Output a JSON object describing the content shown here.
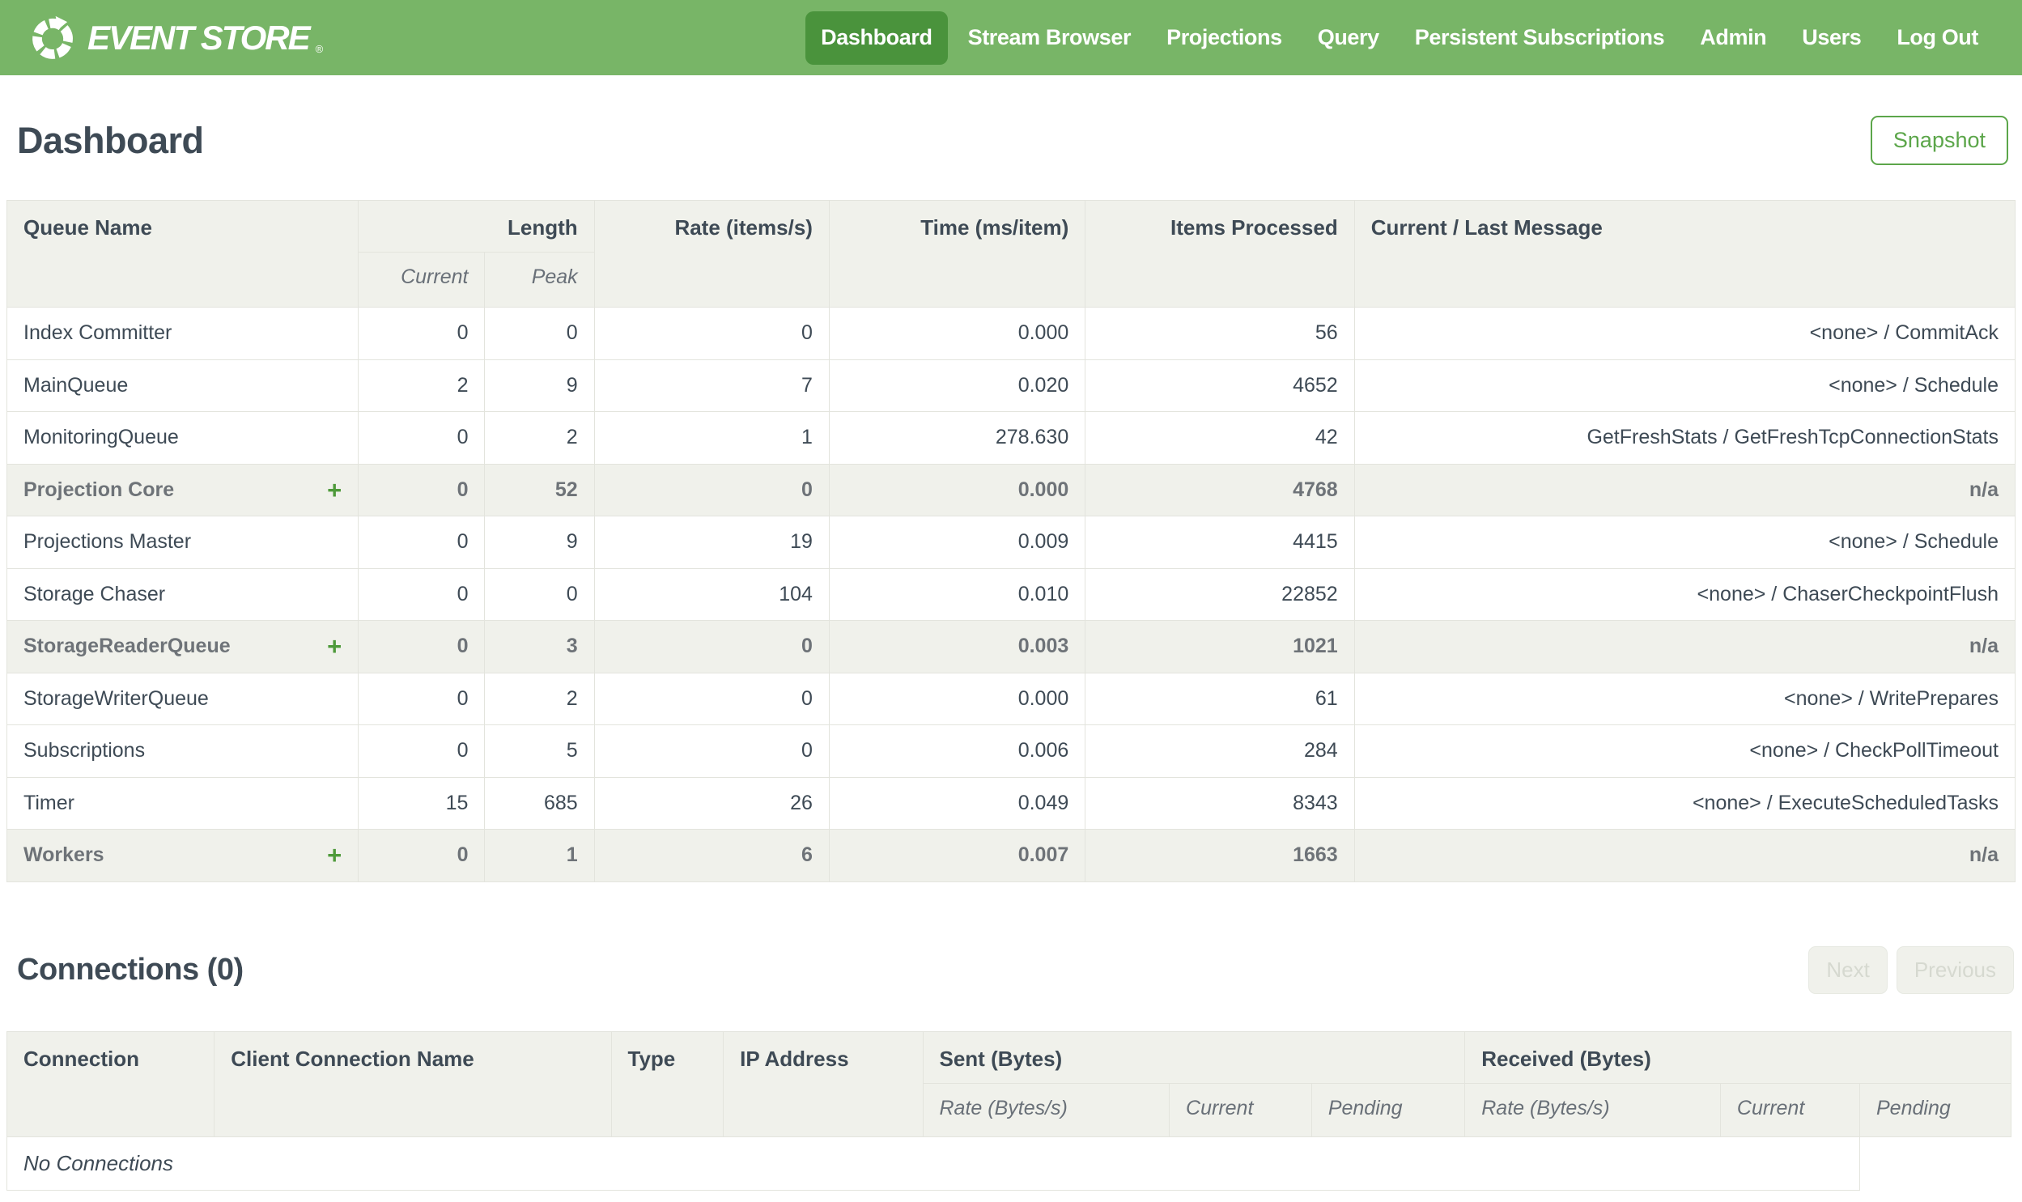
{
  "brand": {
    "name": "EVENT STORE",
    "registered": "®"
  },
  "nav": {
    "items": [
      {
        "label": "Dashboard",
        "active": true
      },
      {
        "label": "Stream Browser",
        "active": false
      },
      {
        "label": "Projections",
        "active": false
      },
      {
        "label": "Query",
        "active": false
      },
      {
        "label": "Persistent Subscriptions",
        "active": false
      },
      {
        "label": "Admin",
        "active": false
      },
      {
        "label": "Users",
        "active": false
      },
      {
        "label": "Log Out",
        "active": false
      }
    ]
  },
  "page": {
    "title": "Dashboard",
    "snapshot_label": "Snapshot"
  },
  "queues_table": {
    "expand_symbol": "+",
    "headers": {
      "queue_name": "Queue Name",
      "length": "Length",
      "current": "Current",
      "peak": "Peak",
      "rate": "Rate (items/s)",
      "time": "Time (ms/item)",
      "items_processed": "Items Processed",
      "message": "Current / Last Message"
    },
    "rows": [
      {
        "name": "Index Committer",
        "expandable": false,
        "current": "0",
        "peak": "0",
        "rate": "0",
        "time": "0.000",
        "items": "56",
        "message": "<none> / CommitAck"
      },
      {
        "name": "MainQueue",
        "expandable": false,
        "current": "2",
        "peak": "9",
        "rate": "7",
        "time": "0.020",
        "items": "4652",
        "message": "<none> / Schedule"
      },
      {
        "name": "MonitoringQueue",
        "expandable": false,
        "current": "0",
        "peak": "2",
        "rate": "1",
        "time": "278.630",
        "items": "42",
        "message": "GetFreshStats / GetFreshTcpConnectionStats"
      },
      {
        "name": "Projection Core",
        "expandable": true,
        "current": "0",
        "peak": "52",
        "rate": "0",
        "time": "0.000",
        "items": "4768",
        "message": "n/a"
      },
      {
        "name": "Projections Master",
        "expandable": false,
        "current": "0",
        "peak": "9",
        "rate": "19",
        "time": "0.009",
        "items": "4415",
        "message": "<none> / Schedule"
      },
      {
        "name": "Storage Chaser",
        "expandable": false,
        "current": "0",
        "peak": "0",
        "rate": "104",
        "time": "0.010",
        "items": "22852",
        "message": "<none> / ChaserCheckpointFlush"
      },
      {
        "name": "StorageReaderQueue",
        "expandable": true,
        "current": "0",
        "peak": "3",
        "rate": "0",
        "time": "0.003",
        "items": "1021",
        "message": "n/a"
      },
      {
        "name": "StorageWriterQueue",
        "expandable": false,
        "current": "0",
        "peak": "2",
        "rate": "0",
        "time": "0.000",
        "items": "61",
        "message": "<none> / WritePrepares"
      },
      {
        "name": "Subscriptions",
        "expandable": false,
        "current": "0",
        "peak": "5",
        "rate": "0",
        "time": "0.006",
        "items": "284",
        "message": "<none> / CheckPollTimeout"
      },
      {
        "name": "Timer",
        "expandable": false,
        "current": "15",
        "peak": "685",
        "rate": "26",
        "time": "0.049",
        "items": "8343",
        "message": "<none> / ExecuteScheduledTasks"
      },
      {
        "name": "Workers",
        "expandable": true,
        "current": "0",
        "peak": "1",
        "rate": "6",
        "time": "0.007",
        "items": "1663",
        "message": "n/a"
      }
    ]
  },
  "connections": {
    "title": "Connections (0)",
    "next_label": "Next",
    "previous_label": "Previous",
    "headers": {
      "connection": "Connection",
      "client_name": "Client Connection Name",
      "type": "Type",
      "ip": "IP Address",
      "sent": "Sent (Bytes)",
      "received": "Received (Bytes)",
      "rate": "Rate (Bytes/s)",
      "current": "Current",
      "pending": "Pending"
    },
    "empty_message": "No Connections"
  },
  "colors": {
    "navbar_green": "#78B567",
    "active_tab_green": "#4A933C",
    "accent_green": "#5CA64A",
    "plus_green": "#4E9A3A",
    "header_bg": "#F0F1EB",
    "border": "#E3E4DD",
    "text_slate": "#3E4A55",
    "group_text_gray": "#6E7378",
    "disabled_text": "#D6D9D0"
  }
}
